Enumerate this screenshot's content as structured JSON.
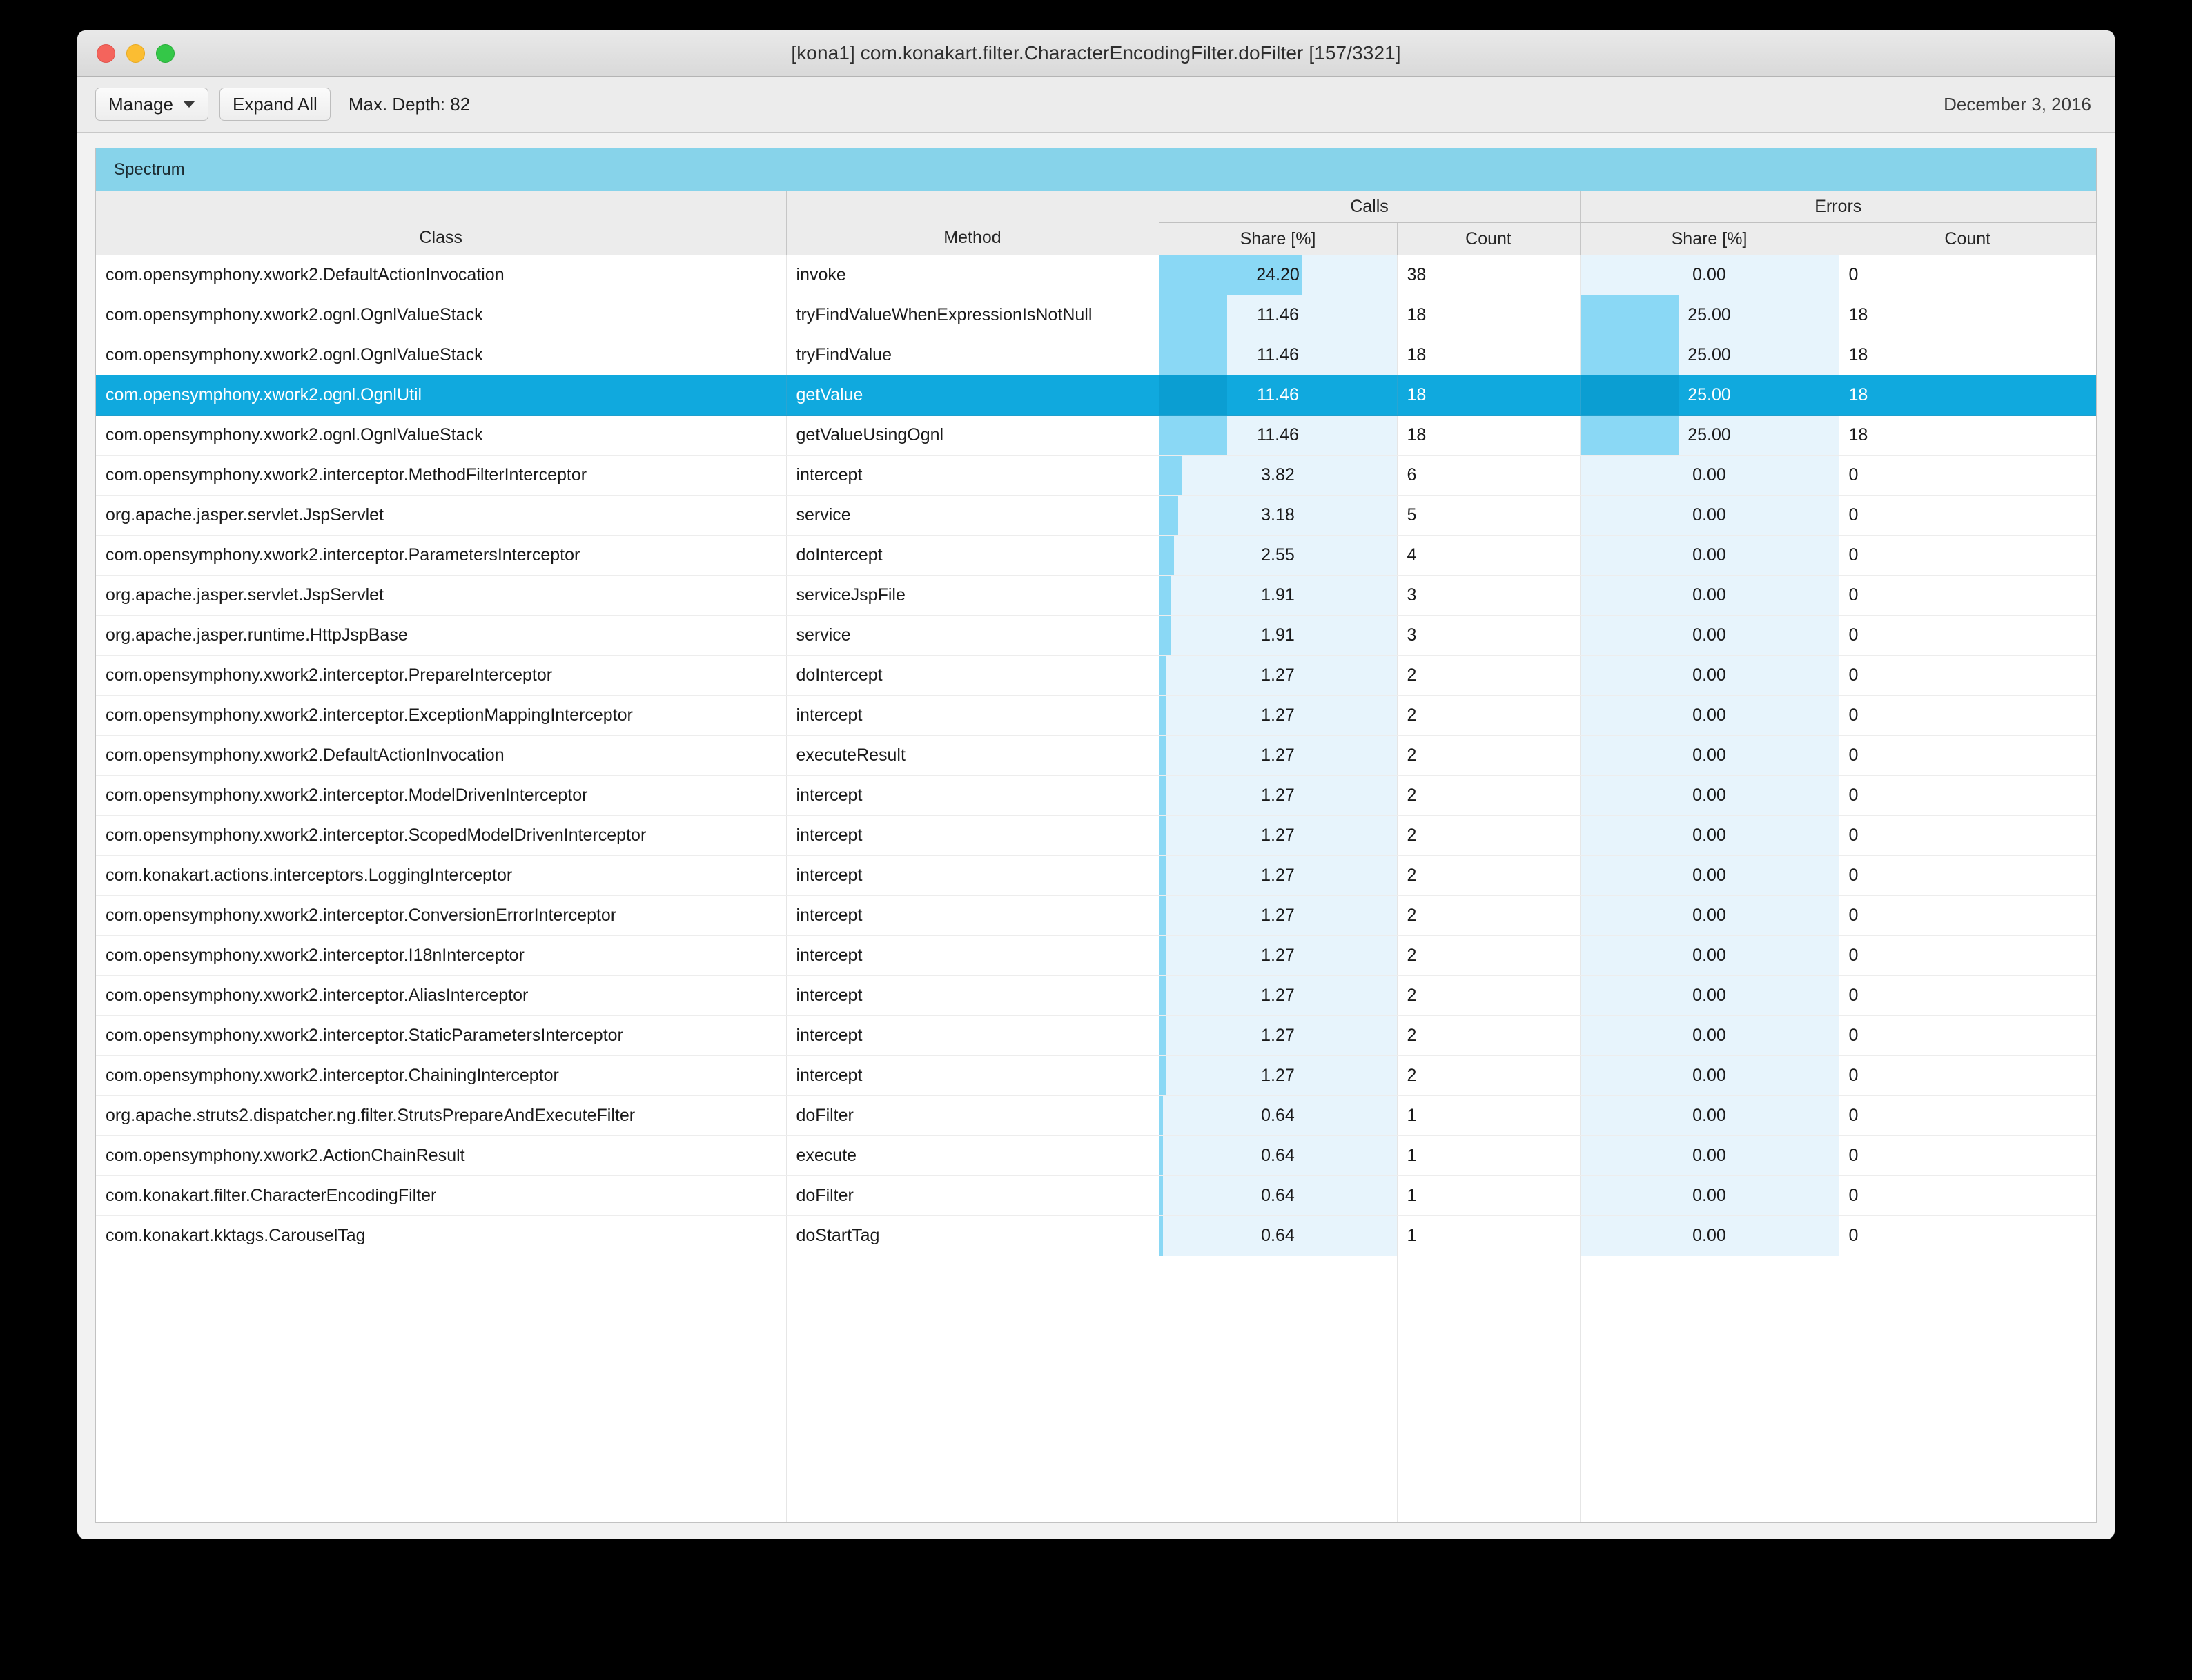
{
  "window": {
    "title": "[kona1] com.konakart.filter.CharacterEncodingFilter.doFilter [157/3321]",
    "controls": {
      "close": "close-button",
      "minimize": "minimize-button",
      "zoom": "zoom-button"
    }
  },
  "toolbar": {
    "manage_label": "Manage",
    "expand_all_label": "Expand All",
    "max_depth_label": "Max. Depth: 82",
    "date_label": "December 3, 2016"
  },
  "tab": {
    "label": "Spectrum"
  },
  "table": {
    "group_headers": [
      {
        "label": "",
        "span": 1
      },
      {
        "label": "",
        "span": 1
      },
      {
        "label": "Calls",
        "span": 2
      },
      {
        "label": "Errors",
        "span": 2
      }
    ],
    "columns": [
      "Class",
      "Method",
      "Share [%]",
      "Count",
      "Share [%]",
      "Count"
    ],
    "max_call_share": 24.2,
    "max_error_share": 25.0,
    "empty_row_count": 8,
    "selected_index": 3,
    "rows": [
      {
        "class": "com.opensymphony.xwork2.DefaultActionInvocation",
        "method": "invoke",
        "call_share": "24.20",
        "call_count": "38",
        "error_share": "0.00",
        "error_count": "0"
      },
      {
        "class": "com.opensymphony.xwork2.ognl.OgnlValueStack",
        "method": "tryFindValueWhenExpressionIsNotNull",
        "call_share": "11.46",
        "call_count": "18",
        "error_share": "25.00",
        "error_count": "18"
      },
      {
        "class": "com.opensymphony.xwork2.ognl.OgnlValueStack",
        "method": "tryFindValue",
        "call_share": "11.46",
        "call_count": "18",
        "error_share": "25.00",
        "error_count": "18"
      },
      {
        "class": "com.opensymphony.xwork2.ognl.OgnlUtil",
        "method": "getValue",
        "call_share": "11.46",
        "call_count": "18",
        "error_share": "25.00",
        "error_count": "18"
      },
      {
        "class": "com.opensymphony.xwork2.ognl.OgnlValueStack",
        "method": "getValueUsingOgnl",
        "call_share": "11.46",
        "call_count": "18",
        "error_share": "25.00",
        "error_count": "18"
      },
      {
        "class": "com.opensymphony.xwork2.interceptor.MethodFilterInterceptor",
        "method": "intercept",
        "call_share": "3.82",
        "call_count": "6",
        "error_share": "0.00",
        "error_count": "0"
      },
      {
        "class": "org.apache.jasper.servlet.JspServlet",
        "method": "service",
        "call_share": "3.18",
        "call_count": "5",
        "error_share": "0.00",
        "error_count": "0"
      },
      {
        "class": "com.opensymphony.xwork2.interceptor.ParametersInterceptor",
        "method": "doIntercept",
        "call_share": "2.55",
        "call_count": "4",
        "error_share": "0.00",
        "error_count": "0"
      },
      {
        "class": "org.apache.jasper.servlet.JspServlet",
        "method": "serviceJspFile",
        "call_share": "1.91",
        "call_count": "3",
        "error_share": "0.00",
        "error_count": "0"
      },
      {
        "class": "org.apache.jasper.runtime.HttpJspBase",
        "method": "service",
        "call_share": "1.91",
        "call_count": "3",
        "error_share": "0.00",
        "error_count": "0"
      },
      {
        "class": "com.opensymphony.xwork2.interceptor.PrepareInterceptor",
        "method": "doIntercept",
        "call_share": "1.27",
        "call_count": "2",
        "error_share": "0.00",
        "error_count": "0"
      },
      {
        "class": "com.opensymphony.xwork2.interceptor.ExceptionMappingInterceptor",
        "method": "intercept",
        "call_share": "1.27",
        "call_count": "2",
        "error_share": "0.00",
        "error_count": "0"
      },
      {
        "class": "com.opensymphony.xwork2.DefaultActionInvocation",
        "method": "executeResult",
        "call_share": "1.27",
        "call_count": "2",
        "error_share": "0.00",
        "error_count": "0"
      },
      {
        "class": "com.opensymphony.xwork2.interceptor.ModelDrivenInterceptor",
        "method": "intercept",
        "call_share": "1.27",
        "call_count": "2",
        "error_share": "0.00",
        "error_count": "0"
      },
      {
        "class": "com.opensymphony.xwork2.interceptor.ScopedModelDrivenInterceptor",
        "method": "intercept",
        "call_share": "1.27",
        "call_count": "2",
        "error_share": "0.00",
        "error_count": "0"
      },
      {
        "class": "com.konakart.actions.interceptors.LoggingInterceptor",
        "method": "intercept",
        "call_share": "1.27",
        "call_count": "2",
        "error_share": "0.00",
        "error_count": "0"
      },
      {
        "class": "com.opensymphony.xwork2.interceptor.ConversionErrorInterceptor",
        "method": "intercept",
        "call_share": "1.27",
        "call_count": "2",
        "error_share": "0.00",
        "error_count": "0"
      },
      {
        "class": "com.opensymphony.xwork2.interceptor.I18nInterceptor",
        "method": "intercept",
        "call_share": "1.27",
        "call_count": "2",
        "error_share": "0.00",
        "error_count": "0"
      },
      {
        "class": "com.opensymphony.xwork2.interceptor.AliasInterceptor",
        "method": "intercept",
        "call_share": "1.27",
        "call_count": "2",
        "error_share": "0.00",
        "error_count": "0"
      },
      {
        "class": "com.opensymphony.xwork2.interceptor.StaticParametersInterceptor",
        "method": "intercept",
        "call_share": "1.27",
        "call_count": "2",
        "error_share": "0.00",
        "error_count": "0"
      },
      {
        "class": "com.opensymphony.xwork2.interceptor.ChainingInterceptor",
        "method": "intercept",
        "call_share": "1.27",
        "call_count": "2",
        "error_share": "0.00",
        "error_count": "0"
      },
      {
        "class": "org.apache.struts2.dispatcher.ng.filter.StrutsPrepareAndExecuteFilter",
        "method": "doFilter",
        "call_share": "0.64",
        "call_count": "1",
        "error_share": "0.00",
        "error_count": "0"
      },
      {
        "class": "com.opensymphony.xwork2.ActionChainResult",
        "method": "execute",
        "call_share": "0.64",
        "call_count": "1",
        "error_share": "0.00",
        "error_count": "0"
      },
      {
        "class": "com.konakart.filter.CharacterEncodingFilter",
        "method": "doFilter",
        "call_share": "0.64",
        "call_count": "1",
        "error_share": "0.00",
        "error_count": "0"
      },
      {
        "class": "com.konakart.kktags.CarouselTag",
        "method": "doStartTag",
        "call_share": "0.64",
        "call_count": "1",
        "error_share": "0.00",
        "error_count": "0"
      }
    ]
  },
  "colors": {
    "tab_background": "#87d3ea",
    "bar": "#8ad8f5",
    "share_cell_background": "#e7f4fc",
    "selection": "#10a9de"
  }
}
